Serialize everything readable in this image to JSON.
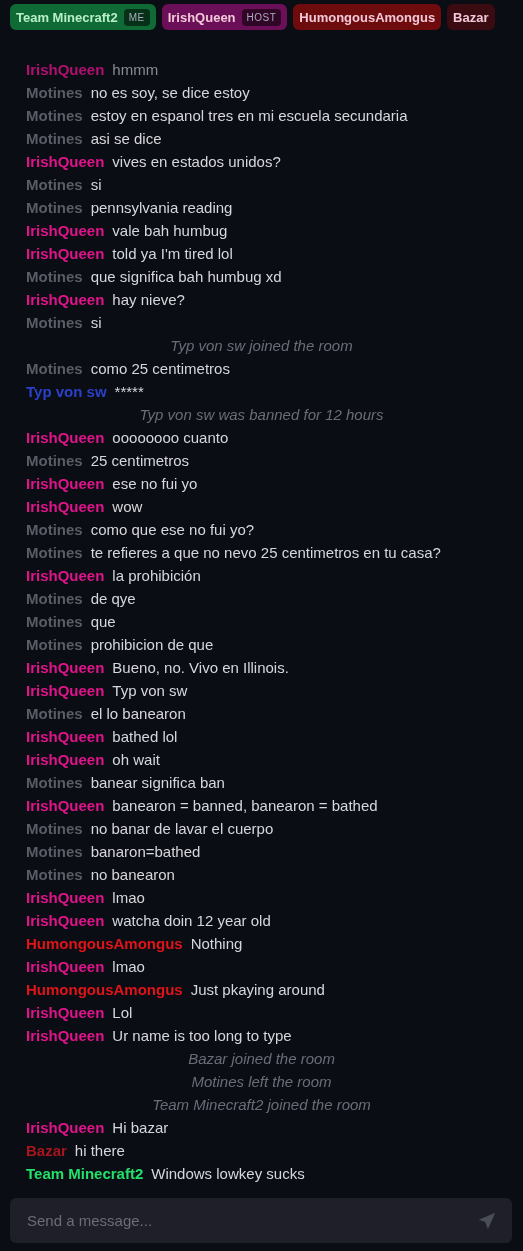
{
  "users": [
    {
      "name": "Team Minecraft2",
      "color": "#0f6a35",
      "badge": "ME"
    },
    {
      "name": "IrishQueen",
      "color": "#6a0f58",
      "badge": "HOST"
    },
    {
      "name": "HumongousAmongus",
      "color": "#6e0b0d"
    },
    {
      "name": "Bazar",
      "color": "#3a0c12"
    }
  ],
  "messages": [
    {
      "kind": "message",
      "author": "IrishQueen",
      "color": "#b01070",
      "text": "hmmm"
    },
    {
      "kind": "message",
      "author": "Motines",
      "color": "#5a5c66",
      "text": "no es soy, se dice estoy"
    },
    {
      "kind": "message",
      "author": "Motines",
      "color": "#5a5c66",
      "text": "estoy en espanol tres en mi escuela secundaria"
    },
    {
      "kind": "message",
      "author": "Motines",
      "color": "#5a5c66",
      "text": "asi se dice"
    },
    {
      "kind": "message",
      "author": "IrishQueen",
      "color": "#e0148a",
      "text": "vives en estados unidos?"
    },
    {
      "kind": "message",
      "author": "Motines",
      "color": "#5a5c66",
      "text": "si"
    },
    {
      "kind": "message",
      "author": "Motines",
      "color": "#5a5c66",
      "text": "pennsylvania reading"
    },
    {
      "kind": "message",
      "author": "IrishQueen",
      "color": "#e0148a",
      "text": "vale bah humbug"
    },
    {
      "kind": "message",
      "author": "IrishQueen",
      "color": "#e0148a",
      "text": "told ya I'm tired lol"
    },
    {
      "kind": "message",
      "author": "Motines",
      "color": "#5a5c66",
      "text": "que significa bah humbug xd"
    },
    {
      "kind": "message",
      "author": "IrishQueen",
      "color": "#e0148a",
      "text": "hay nieve?"
    },
    {
      "kind": "message",
      "author": "Motines",
      "color": "#5a5c66",
      "text": "si"
    },
    {
      "kind": "event",
      "text": "Typ von sw joined the room"
    },
    {
      "kind": "message",
      "author": "Motines",
      "color": "#5a5c66",
      "text": "como 25 centimetros"
    },
    {
      "kind": "message",
      "author": "Typ von sw",
      "color": "#2a40c8",
      "text": "*****"
    },
    {
      "kind": "event",
      "text": "Typ von sw was banned for 12 hours"
    },
    {
      "kind": "message",
      "author": "IrishQueen",
      "color": "#e0148a",
      "text": "oooooooo cuanto"
    },
    {
      "kind": "message",
      "author": "Motines",
      "color": "#5a5c66",
      "text": "25 centimetros"
    },
    {
      "kind": "message",
      "author": "IrishQueen",
      "color": "#e0148a",
      "text": "ese no fui yo"
    },
    {
      "kind": "message",
      "author": "IrishQueen",
      "color": "#e0148a",
      "text": "wow"
    },
    {
      "kind": "message",
      "author": "Motines",
      "color": "#5a5c66",
      "text": "como que ese no fui yo?"
    },
    {
      "kind": "message",
      "author": "Motines",
      "color": "#5a5c66",
      "text": "te refieres a que no nevo 25 centimetros en tu casa?"
    },
    {
      "kind": "message",
      "author": "IrishQueen",
      "color": "#e0148a",
      "text": "la prohibición"
    },
    {
      "kind": "message",
      "author": "Motines",
      "color": "#5a5c66",
      "text": "de qye"
    },
    {
      "kind": "message",
      "author": "Motines",
      "color": "#5a5c66",
      "text": "que"
    },
    {
      "kind": "message",
      "author": "Motines",
      "color": "#5a5c66",
      "text": "prohibicion de que"
    },
    {
      "kind": "message",
      "author": "IrishQueen",
      "color": "#e0148a",
      "text": "Bueno, no. Vivo en Illinois."
    },
    {
      "kind": "message",
      "author": "IrishQueen",
      "color": "#e0148a",
      "text": "Typ von sw"
    },
    {
      "kind": "message",
      "author": "Motines",
      "color": "#5a5c66",
      "text": "el lo banearon"
    },
    {
      "kind": "message",
      "author": "IrishQueen",
      "color": "#e0148a",
      "text": "bathed lol"
    },
    {
      "kind": "message",
      "author": "IrishQueen",
      "color": "#e0148a",
      "text": "oh wait"
    },
    {
      "kind": "message",
      "author": "Motines",
      "color": "#5a5c66",
      "text": "banear significa ban"
    },
    {
      "kind": "message",
      "author": "IrishQueen",
      "color": "#e0148a",
      "text": "banearon = banned, banearon = bathed"
    },
    {
      "kind": "message",
      "author": "Motines",
      "color": "#5a5c66",
      "text": "no banar de lavar el cuerpo"
    },
    {
      "kind": "message",
      "author": "Motines",
      "color": "#5a5c66",
      "text": "banaron=bathed"
    },
    {
      "kind": "message",
      "author": "Motines",
      "color": "#5a5c66",
      "text": "no banearon"
    },
    {
      "kind": "message",
      "author": "IrishQueen",
      "color": "#e0148a",
      "text": "lmao"
    },
    {
      "kind": "message",
      "author": "IrishQueen",
      "color": "#e0148a",
      "text": "watcha doin 12 year old"
    },
    {
      "kind": "message",
      "author": "HumongousAmongus",
      "color": "#e01418",
      "text": "Nothing"
    },
    {
      "kind": "message",
      "author": "IrishQueen",
      "color": "#e0148a",
      "text": "lmao"
    },
    {
      "kind": "message",
      "author": "HumongousAmongus",
      "color": "#e01418",
      "text": "Just pkaying around"
    },
    {
      "kind": "message",
      "author": "IrishQueen",
      "color": "#e0148a",
      "text": "Lol"
    },
    {
      "kind": "message",
      "author": "IrishQueen",
      "color": "#e0148a",
      "text": "Ur name is too long to type"
    },
    {
      "kind": "event",
      "text": "Bazar joined the room"
    },
    {
      "kind": "event",
      "text": "Motines left the room"
    },
    {
      "kind": "event",
      "text": "Team Minecraft2 joined the room"
    },
    {
      "kind": "message",
      "author": "IrishQueen",
      "color": "#e0148a",
      "text": "Hi bazar"
    },
    {
      "kind": "message",
      "author": "Bazar",
      "color": "#a8161c",
      "text": "hi there"
    },
    {
      "kind": "message",
      "author": "Team Minecraft2",
      "color": "#22e06a",
      "text": "Windows lowkey sucks"
    }
  ],
  "composer": {
    "placeholder": "Send a message..."
  }
}
